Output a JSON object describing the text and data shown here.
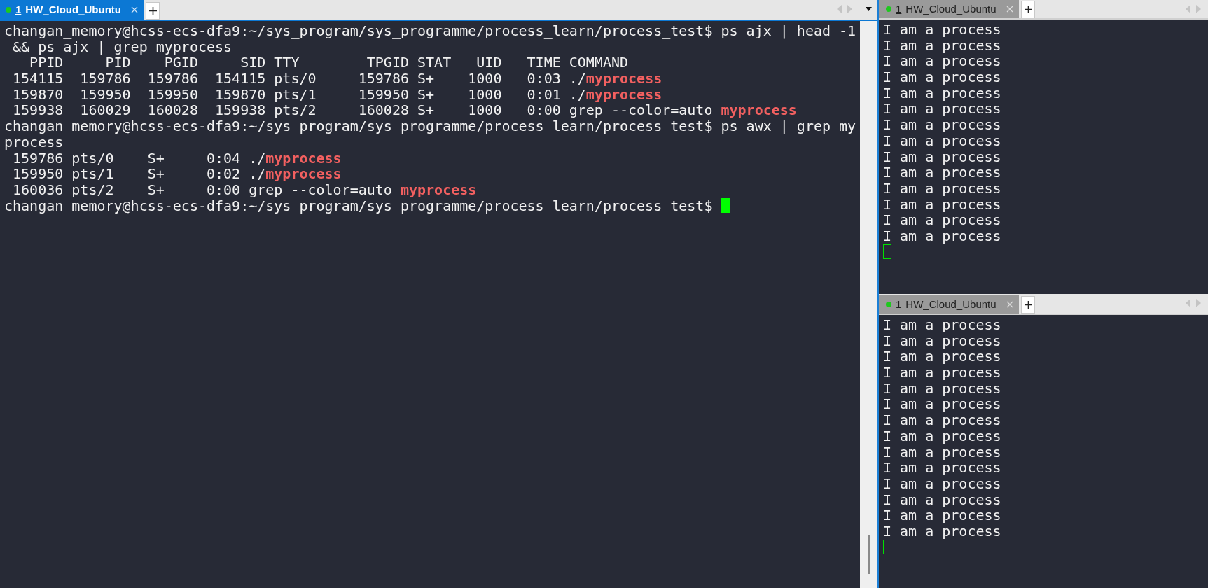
{
  "panes": [
    {
      "tab": {
        "number": "1",
        "title": "HW_Cloud_Ubuntu",
        "selected": true,
        "color": "#1ec81e"
      },
      "cursor_focused": true,
      "lines": [
        "changan_memory@hcss-ecs-dfa9:~/sys_program/sys_programme/process_learn/process_test$ ps ajx | head -1",
        " && ps ajx | grep myprocess",
        "   PPID     PID    PGID     SID TTY        TPGID STAT   UID   TIME COMMAND",
        " 154115  159786  159786  154115 pts/0     159786 S+    1000   0:03 ./**myprocess**",
        " 159870  159950  159950  159870 pts/1     159950 S+    1000   0:01 ./**myprocess**",
        " 159938  160029  160028  159938 pts/2     160028 S+    1000   0:00 grep --color=auto **myprocess**",
        "changan_memory@hcss-ecs-dfa9:~/sys_program/sys_programme/process_learn/process_test$ ps awx | grep my",
        "process",
        " 159786 pts/0    S+     0:04 ./**myprocess**",
        " 159950 pts/1    S+     0:02 ./**myprocess**",
        " 160036 pts/2    S+     0:00 grep --color=auto **myprocess**",
        "changan_memory@hcss-ecs-dfa9:~/sys_program/sys_programme/process_learn/process_test$ "
      ]
    },
    {
      "tab": {
        "number": "1",
        "title": "HW_Cloud_Ubuntu",
        "selected": false,
        "color": "#1ec81e"
      },
      "cursor_focused": false,
      "lines": [
        "I am a process",
        "I am a process",
        "I am a process",
        "I am a process",
        "I am a process",
        "I am a process",
        "I am a process",
        "I am a process",
        "I am a process",
        "I am a process",
        "I am a process",
        "I am a process",
        "I am a process",
        "I am a process"
      ]
    },
    {
      "tab": {
        "number": "1",
        "title": "HW_Cloud_Ubuntu",
        "selected": false,
        "color": "#1ec81e"
      },
      "cursor_focused": false,
      "lines": [
        "I am a process",
        "I am a process",
        "I am a process",
        "I am a process",
        "I am a process",
        "I am a process",
        "I am a process",
        "I am a process",
        "I am a process",
        "I am a process",
        "I am a process",
        "I am a process",
        "I am a process",
        "I am a process"
      ]
    }
  ]
}
